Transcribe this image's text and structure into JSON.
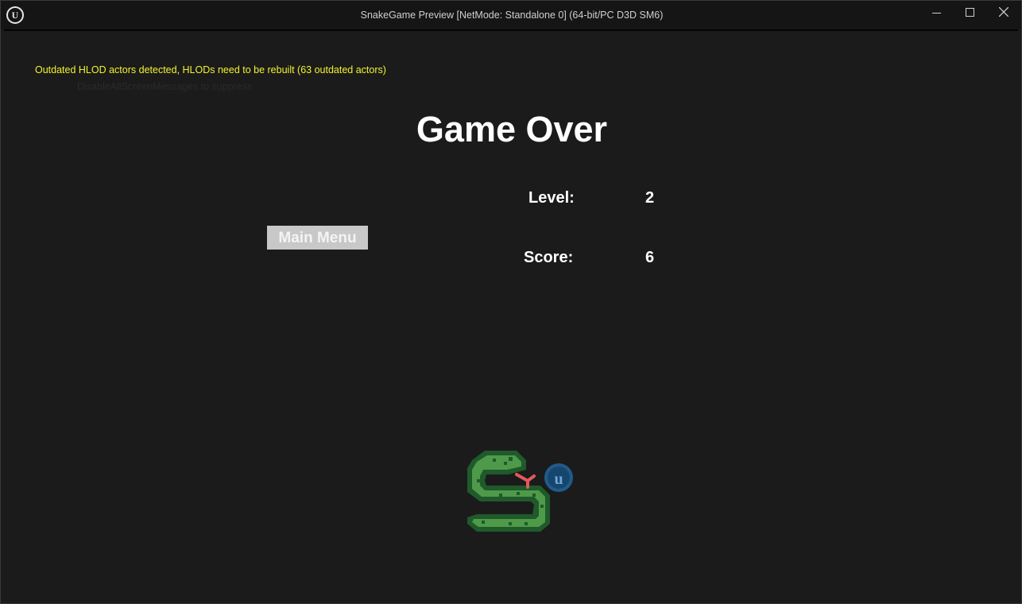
{
  "window": {
    "title": "SnakeGame Preview [NetMode: Standalone 0]  (64-bit/PC D3D SM6)",
    "app_icon": "unreal-engine-icon",
    "controls": [
      "minimize-icon",
      "maximize-icon",
      "close-icon"
    ]
  },
  "viewport": {
    "warning": "Outdated HLOD actors detected, HLODs need to be rebuilt (63 outdated actors)",
    "faint_message": "DisableAllScreenMessages to suppress",
    "title": "Game Over",
    "stats": {
      "level_label": "Level:",
      "level_value": "2",
      "score_label": "Score:",
      "score_value": "6"
    },
    "main_menu_label": "Main Menu",
    "logo": "snake-with-unreal-logo"
  },
  "colors": {
    "background": "#1b1b1b",
    "warning": "#f2f231",
    "button": "#c8c8c8",
    "snake_green": "#4e9a4a",
    "snake_outline": "#1f5a2a",
    "tongue": "#e05a5a",
    "badge_blue": "#1f5b8c"
  }
}
